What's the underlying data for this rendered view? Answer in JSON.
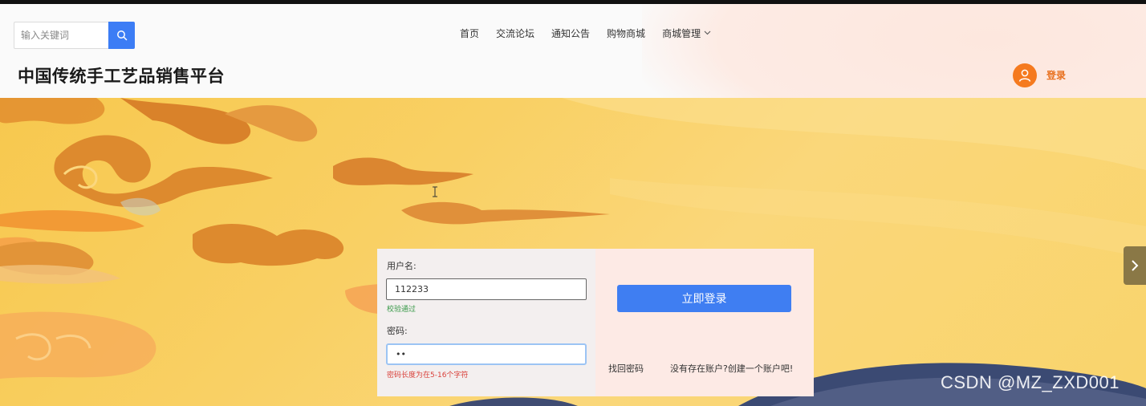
{
  "header": {
    "search": {
      "placeholder": "输入关键词",
      "value": ""
    },
    "nav": [
      {
        "label": "首页"
      },
      {
        "label": "交流论坛"
      },
      {
        "label": "通知公告"
      },
      {
        "label": "购物商城"
      },
      {
        "label": "商城管理"
      }
    ],
    "site_title": "中国传统手工艺品销售平台",
    "login_label": "登录"
  },
  "login_form": {
    "username_label": "用户名:",
    "username_value": "112233",
    "username_hint": "校验通过",
    "password_label": "密码:",
    "password_value": "••",
    "password_hint": "密码长度为在5-16个字符",
    "submit_label": "立即登录",
    "forgot_label": "找回密码",
    "register_label": "没有存在账户?创建一个账户吧!"
  },
  "watermark": "CSDN @MZ_ZXD001",
  "colors": {
    "accent": "#3f7ef2",
    "orange": "#f57a1f",
    "success": "#3a9a4a",
    "error": "#d9403a"
  },
  "icons": {
    "search": "search-icon",
    "dropdown": "chevron-down-icon",
    "avatar": "user-icon",
    "next": "chevron-right-icon"
  }
}
